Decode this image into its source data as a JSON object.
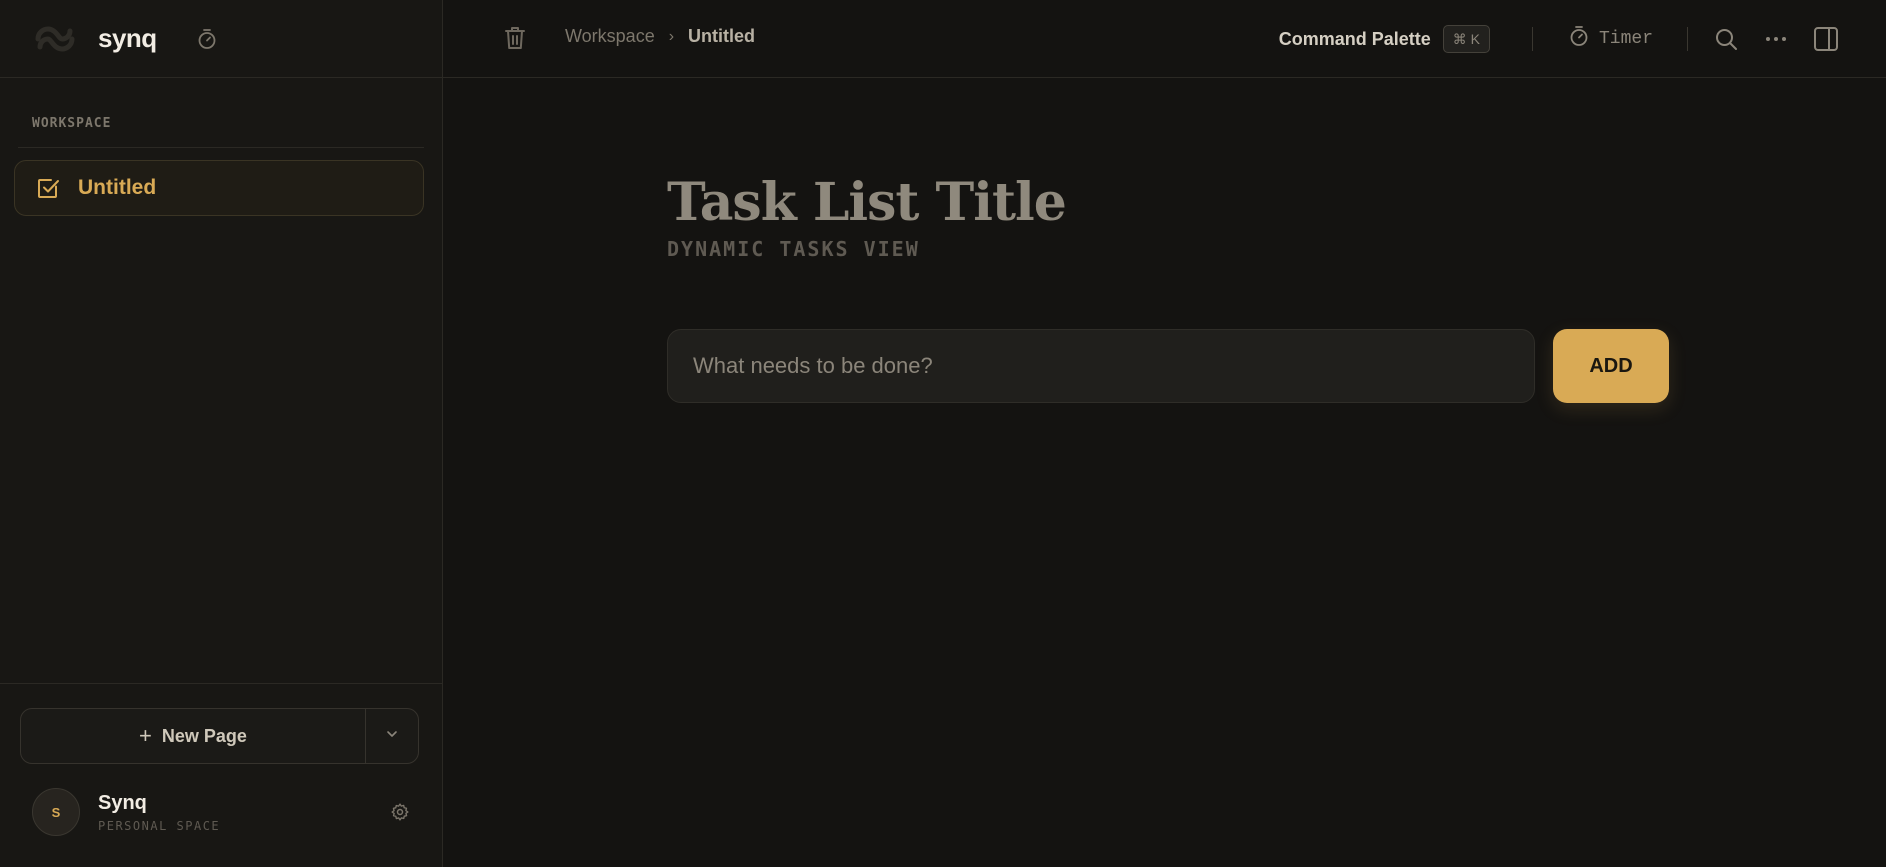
{
  "app": {
    "brand": "synq"
  },
  "sidebar": {
    "section_label": "WORKSPACE",
    "pages": [
      {
        "label": "Untitled",
        "icon": "checkbox-icon",
        "active": true
      }
    ],
    "new_page_label": "New Page",
    "user": {
      "initial": "S",
      "name": "Synq",
      "subtitle": "PERSONAL SPACE"
    }
  },
  "topbar": {
    "breadcrumb": {
      "workspace": "Workspace",
      "separator": "›",
      "current": "Untitled"
    },
    "command_palette": {
      "label": "Command Palette",
      "shortcut": "⌘ K"
    },
    "timer_label": "Timer"
  },
  "main": {
    "title": "Task List Title",
    "subtitle": "DYNAMIC TASKS VIEW",
    "input_placeholder": "What needs to be done?",
    "add_label": "ADD"
  },
  "colors": {
    "accent": "#d9aa55",
    "background": "#141311",
    "sidebar": "#181714",
    "border": "#2b2924"
  }
}
